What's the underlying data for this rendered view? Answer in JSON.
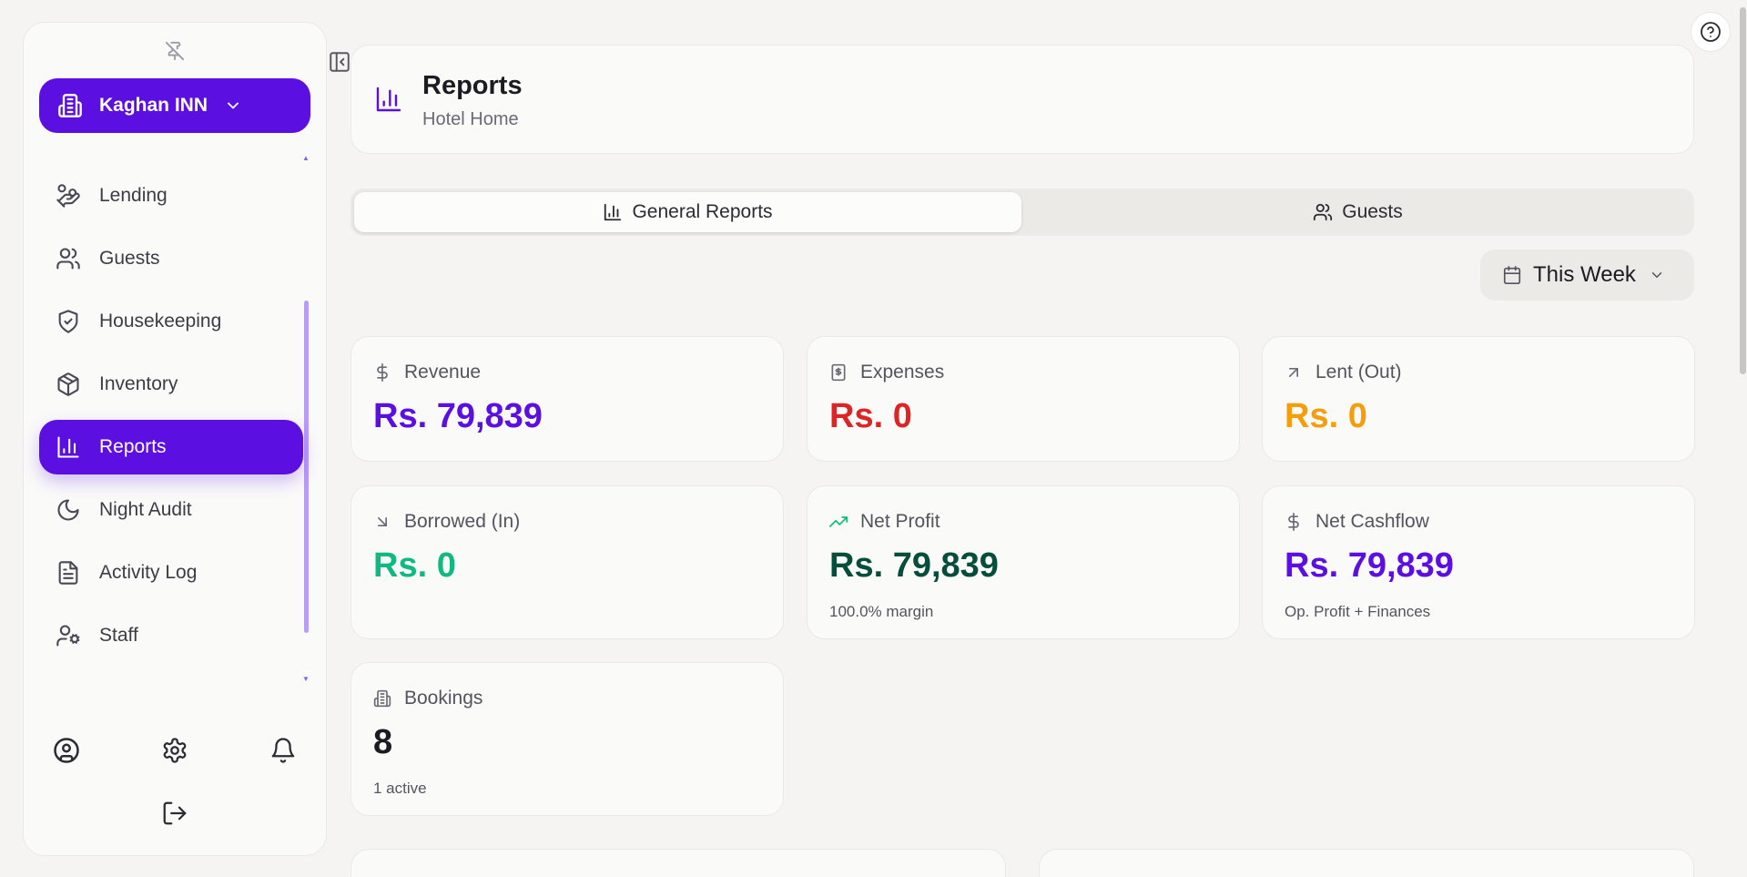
{
  "sidebar": {
    "hotel_name": "Kaghan INN",
    "nav": [
      {
        "label": "Lending",
        "icon": "hand-coins-icon"
      },
      {
        "label": "Guests",
        "icon": "users-icon"
      },
      {
        "label": "Housekeeping",
        "icon": "shield-check-icon"
      },
      {
        "label": "Inventory",
        "icon": "package-icon"
      },
      {
        "label": "Reports",
        "icon": "bar-chart-icon",
        "active": true
      },
      {
        "label": "Night Audit",
        "icon": "moon-icon"
      },
      {
        "label": "Activity Log",
        "icon": "file-text-icon"
      },
      {
        "label": "Staff",
        "icon": "user-cog-icon"
      }
    ]
  },
  "header": {
    "title": "Reports",
    "subtitle": "Hotel Home"
  },
  "tabs": [
    {
      "label": "General Reports",
      "active": true
    },
    {
      "label": "Guests",
      "active": false
    }
  ],
  "range": {
    "label": "This Week"
  },
  "stats": {
    "revenue": {
      "label": "Revenue",
      "value": "Rs. 79,839",
      "color": "#5b0fe0"
    },
    "expenses": {
      "label": "Expenses",
      "value": "Rs. 0",
      "color": "#dc2626"
    },
    "lent": {
      "label": "Lent (Out)",
      "value": "Rs. 0",
      "color": "#f59e0b"
    },
    "borrowed": {
      "label": "Borrowed (In)",
      "value": "Rs. 0",
      "color": "#10b981"
    },
    "net_profit": {
      "label": "Net Profit",
      "value": "Rs. 79,839",
      "note": "100.0% margin",
      "color": "#064e3b"
    },
    "net_cashflow": {
      "label": "Net Cashflow",
      "value": "Rs. 79,839",
      "note": "Op. Profit + Finances",
      "color": "#5b0fe0"
    },
    "bookings": {
      "label": "Bookings",
      "value": "8",
      "note": "1 active",
      "color": "#1c1b22"
    }
  },
  "colors": {
    "accent": "#5b0fe0",
    "background": "#f5f4f2"
  }
}
